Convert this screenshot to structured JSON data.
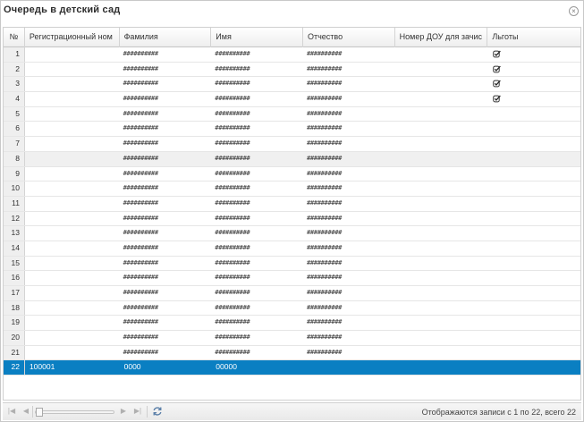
{
  "window": {
    "title": "Очередь в детский сад"
  },
  "grid": {
    "columns": [
      "№",
      "Регистрационный ном",
      "Фамилия",
      "Имя",
      "Отчество",
      "Номер ДОУ для зачис",
      "Льготы"
    ],
    "rows": [
      {
        "n": "1",
        "reg": "",
        "last": "##########",
        "first": "##########",
        "middle": "##########",
        "dou": "",
        "benefit": true
      },
      {
        "n": "2",
        "reg": "",
        "last": "##########",
        "first": "##########",
        "middle": "##########",
        "dou": "",
        "benefit": true
      },
      {
        "n": "3",
        "reg": "",
        "last": "##########",
        "first": "##########",
        "middle": "##########",
        "dou": "",
        "benefit": true
      },
      {
        "n": "4",
        "reg": "",
        "last": "##########",
        "first": "##########",
        "middle": "##########",
        "dou": "",
        "benefit": true
      },
      {
        "n": "5",
        "reg": "",
        "last": "##########",
        "first": "##########",
        "middle": "##########",
        "dou": "",
        "benefit": false
      },
      {
        "n": "6",
        "reg": "",
        "last": "##########",
        "first": "##########",
        "middle": "##########",
        "dou": "",
        "benefit": false
      },
      {
        "n": "7",
        "reg": "",
        "last": "##########",
        "first": "##########",
        "middle": "##########",
        "dou": "",
        "benefit": false
      },
      {
        "n": "8",
        "reg": "",
        "last": "##########",
        "first": "##########",
        "middle": "##########",
        "dou": "",
        "benefit": false
      },
      {
        "n": "9",
        "reg": "",
        "last": "##########",
        "first": "##########",
        "middle": "##########",
        "dou": "",
        "benefit": false
      },
      {
        "n": "10",
        "reg": "",
        "last": "##########",
        "first": "##########",
        "middle": "##########",
        "dou": "",
        "benefit": false
      },
      {
        "n": "11",
        "reg": "",
        "last": "##########",
        "first": "##########",
        "middle": "##########",
        "dou": "",
        "benefit": false
      },
      {
        "n": "12",
        "reg": "",
        "last": "##########",
        "first": "##########",
        "middle": "##########",
        "dou": "",
        "benefit": false
      },
      {
        "n": "13",
        "reg": "",
        "last": "##########",
        "first": "##########",
        "middle": "##########",
        "dou": "",
        "benefit": false
      },
      {
        "n": "14",
        "reg": "",
        "last": "##########",
        "first": "##########",
        "middle": "##########",
        "dou": "",
        "benefit": false
      },
      {
        "n": "15",
        "reg": "",
        "last": "##########",
        "first": "##########",
        "middle": "##########",
        "dou": "",
        "benefit": false
      },
      {
        "n": "16",
        "reg": "",
        "last": "##########",
        "first": "##########",
        "middle": "##########",
        "dou": "",
        "benefit": false
      },
      {
        "n": "17",
        "reg": "",
        "last": "##########",
        "first": "##########",
        "middle": "##########",
        "dou": "",
        "benefit": false
      },
      {
        "n": "18",
        "reg": "",
        "last": "##########",
        "first": "##########",
        "middle": "##########",
        "dou": "",
        "benefit": false
      },
      {
        "n": "19",
        "reg": "",
        "last": "##########",
        "first": "##########",
        "middle": "##########",
        "dou": "",
        "benefit": false
      },
      {
        "n": "20",
        "reg": "",
        "last": "##########",
        "first": "##########",
        "middle": "##########",
        "dou": "",
        "benefit": false
      },
      {
        "n": "21",
        "reg": "",
        "last": "##########",
        "first": "##########",
        "middle": "##########",
        "dou": "",
        "benefit": false
      },
      {
        "n": "22",
        "reg": "100001",
        "last": "0000",
        "first": "00000",
        "middle": "",
        "dou": "",
        "benefit": false
      }
    ],
    "selected_row": "22",
    "hover_row": "8"
  },
  "pager": {
    "status": "Отображаются записи с 1 по 22, всего 22"
  },
  "colors": {
    "selection": "#0a7fc2",
    "header_bg": "#eeeeee",
    "rownum_bg": "#efefef"
  }
}
